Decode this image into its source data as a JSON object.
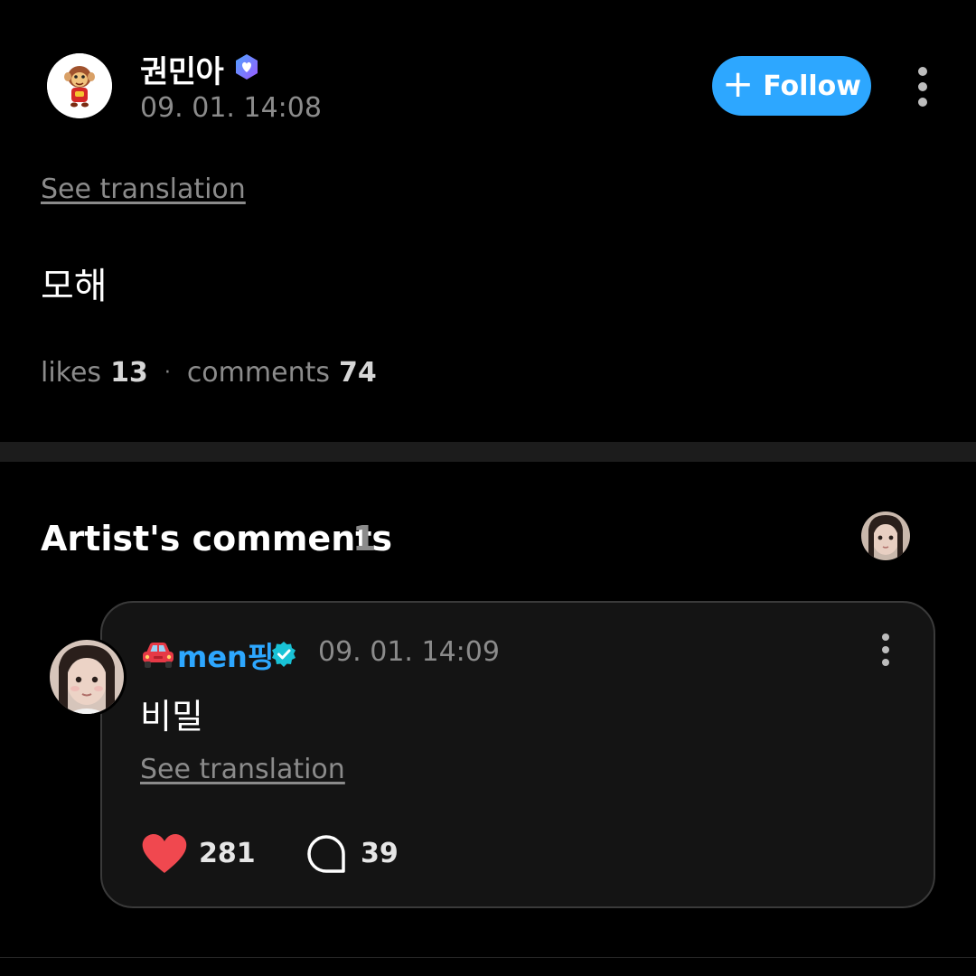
{
  "post": {
    "author": "권민아",
    "time": "09. 01. 14:08",
    "follow_label": "Follow",
    "see_translation": "See translation",
    "body": "모해",
    "likes_label": "likes",
    "likes_count": "13",
    "comments_label": "comments",
    "comments_count": "74"
  },
  "artist_comments": {
    "title": "Artist's comments",
    "count": "1",
    "comment": {
      "author": "men핑",
      "time": "09. 01. 14:09",
      "body": "비밀",
      "see_translation": "See translation",
      "likes": "281",
      "replies": "39"
    }
  },
  "colors": {
    "accent": "#2da7ff",
    "heart": "#f0484f",
    "muted": "#8b8b8b",
    "background": "#000000"
  },
  "icons": [
    "verified-badge-icon",
    "plus-icon",
    "more-vertical-icon",
    "car-emoji-icon",
    "heart-icon",
    "comment-bubble-icon"
  ]
}
